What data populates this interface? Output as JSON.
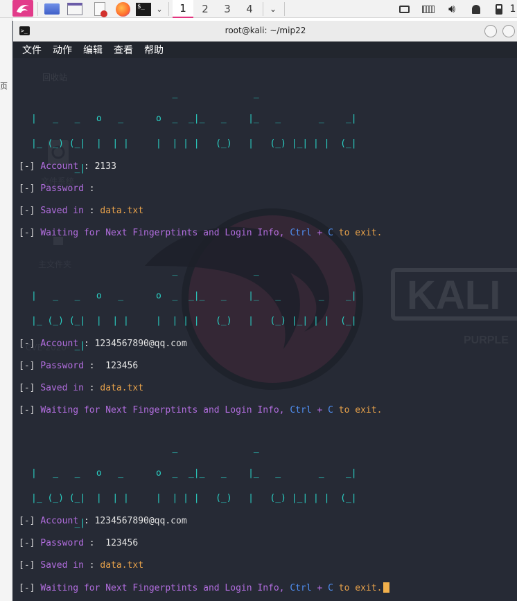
{
  "taskbar": {
    "workspaces": [
      "1",
      "2",
      "3",
      "4"
    ],
    "active_workspace": "1",
    "right_text": "1"
  },
  "desktop": {
    "edge_text": "页"
  },
  "window": {
    "title": "root@kali: ~/mip22",
    "menu": [
      "文件",
      "动作",
      "编辑",
      "查看",
      "帮助"
    ]
  },
  "terminal": {
    "banner_lines": [
      "                          _              _                   ",
      "|   _   _   o   _      o  _  _|_   _    |_   _       _    _| ",
      "|_ (_) (_|  |  | |     |  | | |   (_)   |   (_) |_| | |  (_| ",
      "        _|                                                   "
    ],
    "blocks": [
      {
        "account_label": "Account",
        "account_value": "2133",
        "password_label": "Password",
        "password_value": "",
        "saved_label": "Saved in",
        "saved_file": "data.txt",
        "waiting_text": "Waiting for Next Fingerptints and Login Info,",
        "ctrl_text": "Ctrl",
        "plus_text": "+",
        "c_text": "C",
        "exit_text": "to exit."
      },
      {
        "account_label": "Account",
        "account_value": "1234567890@qq.com",
        "password_label": "Password",
        "password_value": " 123456",
        "saved_label": "Saved in",
        "saved_file": "data.txt",
        "waiting_text": "Waiting for Next Fingerptints and Login Info,",
        "ctrl_text": "Ctrl",
        "plus_text": "+",
        "c_text": "C",
        "exit_text": "to exit."
      },
      {
        "account_label": "Account",
        "account_value": "1234567890@qq.com",
        "password_label": "Password",
        "password_value": " 123456",
        "saved_label": "Saved in",
        "saved_file": "data.txt",
        "waiting_text": "Waiting for Next Fingerptints and Login Info,",
        "ctrl_text": "Ctrl",
        "plus_text": "+",
        "c_text": "C",
        "exit_text": "to exit."
      }
    ],
    "prefix": "[-]",
    "colon": ":"
  },
  "wallpaper_text": {
    "brand": "KALI",
    "brand_sub": "PURPLE",
    "desktop_labels": [
      "回收站",
      "文件系统",
      "主文件夹",
      "CVE-2020-"
    ]
  },
  "colors": {
    "terminal_bg": "#262a35",
    "banner": "#2ad2c6",
    "key": "#b36ee0",
    "file": "#e8a24a",
    "ctrl": "#4f8ef0",
    "cursor": "#f1b04c",
    "kali_accent": "#e23b8a"
  }
}
